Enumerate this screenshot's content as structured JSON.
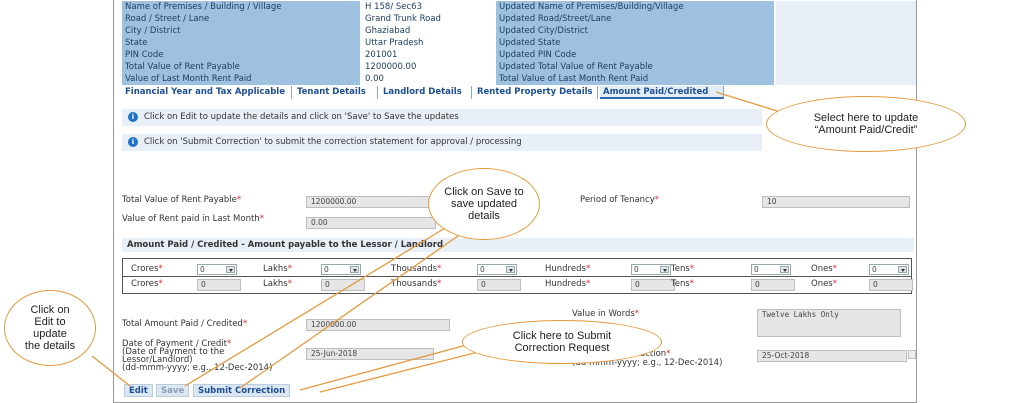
{
  "summary_rows": [
    {
      "label": "Name of Premises / Building / Village",
      "value": "H 158/ Sec63",
      "updated": "Updated Name of Premises/Building/Village"
    },
    {
      "label": "Road / Street / Lane",
      "value": "Grand Trunk Road",
      "updated": "Updated Road/Street/Lane"
    },
    {
      "label": "City / District",
      "value": "Ghaziabad",
      "updated": "Updated City/District"
    },
    {
      "label": "State",
      "value": "Uttar Pradesh",
      "updated": "Updated State"
    },
    {
      "label": "PIN Code",
      "value": "201001",
      "updated": "Updated PIN Code"
    },
    {
      "label": "Total Value of Rent Payable",
      "value": "1200000.00",
      "updated": "Updated Total Value of Rent Payable"
    },
    {
      "label": "Value of Last Month Rent Paid",
      "value": "0.00",
      "updated": "Total Value of Last Month Rent Paid"
    }
  ],
  "tabs": [
    "Financial Year and Tax Applicable",
    "Tenant Details",
    "Landlord Details",
    "Rented Property Details",
    "Amount Paid/Credited"
  ],
  "info": {
    "edit_msg": "Click on Edit to update the details and click on 'Save' to Save the updates",
    "submit_msg": "Click on 'Submit Correction' to submit the correction statement for approval / processing"
  },
  "form": {
    "total_rent_label": "Total Value of Rent Payable",
    "total_rent_value": "1200000.00",
    "period_label": "Period of Tenancy",
    "period_value": "10",
    "last_month_label": "Value of Rent paid in Last Month",
    "last_month_value": "0.00",
    "section_title": "Amount Paid / Credited - Amount payable to the Lessor / Landlord",
    "units": [
      "Crores",
      "Lakhs",
      "Thousands",
      "Hundreds",
      "Tens",
      "Ones"
    ],
    "dropdown_value": "0",
    "text_value": "0",
    "value_in_words_label": "Value in Words",
    "value_in_words": "Twelve Lakhs Only",
    "total_paid_label": "Total Amount Paid / Credited",
    "total_paid_value": "1200000.00",
    "date_payment_label_1": "Date of Payment / Credit",
    "date_payment_label_2": "(Date of Payment to the",
    "date_payment_label_3": "Lessor/Landlord)",
    "date_payment_label_4": "(dd-mmm-yyyy; e.g., 12-Dec-2014)",
    "date_payment_value": "25-Jun-2018",
    "date_tax_label_1": "Date of Tax Deduction",
    "date_tax_label_2": "(dd-mmm-yyyy; e.g., 12-Dec-2014)",
    "date_tax_value": "25-Oct-2018",
    "required_mark": "*"
  },
  "buttons": {
    "edit": "Edit",
    "save": "Save",
    "submit": "Submit Correction"
  },
  "callouts": {
    "amount_paid": [
      "Select here to update",
      "“Amount Paid/Credit”"
    ],
    "save": [
      "Click on Save to",
      "save updated",
      "details"
    ],
    "edit": [
      "Click on",
      "Edit to",
      "update",
      "the details"
    ],
    "submit": [
      "Click here to  Submit",
      "Correction Request"
    ]
  },
  "colors": {
    "header_blue": "#9ec1e0",
    "tab_text": "#1e4f95",
    "callout_border": "#e39a3e",
    "required": "#e0262b"
  }
}
